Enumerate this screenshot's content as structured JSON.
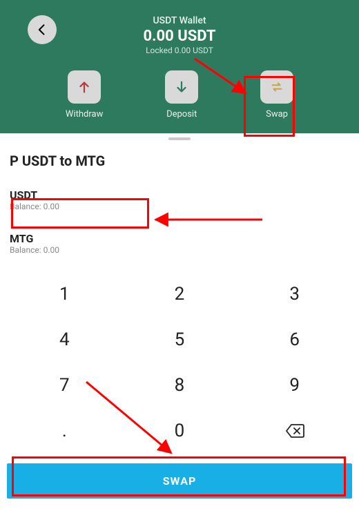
{
  "header": {
    "wallet_title": "USDT Wallet",
    "balance": "0.00 USDT",
    "locked": "Locked 0.00 USDT",
    "actions": {
      "withdraw": "Withdraw",
      "deposit": "Deposit",
      "swap": "Swap"
    }
  },
  "sheet": {
    "title": "P USDT to MTG",
    "from": {
      "symbol": "USDT",
      "balance_label": "Balance: 0.00"
    },
    "to": {
      "symbol": "MTG",
      "balance_label": "Balance: 0.00"
    }
  },
  "keypad": {
    "k1": "1",
    "k2": "2",
    "k3": "3",
    "k4": "4",
    "k5": "5",
    "k6": "6",
    "k7": "7",
    "k8": "8",
    "k9": "9",
    "kdot": ".",
    "k0": "0"
  },
  "swap_button": "SWAP",
  "colors": {
    "header_bg": "#2d7a5f",
    "tile_bg": "#d9d9d9",
    "swap_bg": "#18aee6",
    "annotation": "#ff0000"
  }
}
